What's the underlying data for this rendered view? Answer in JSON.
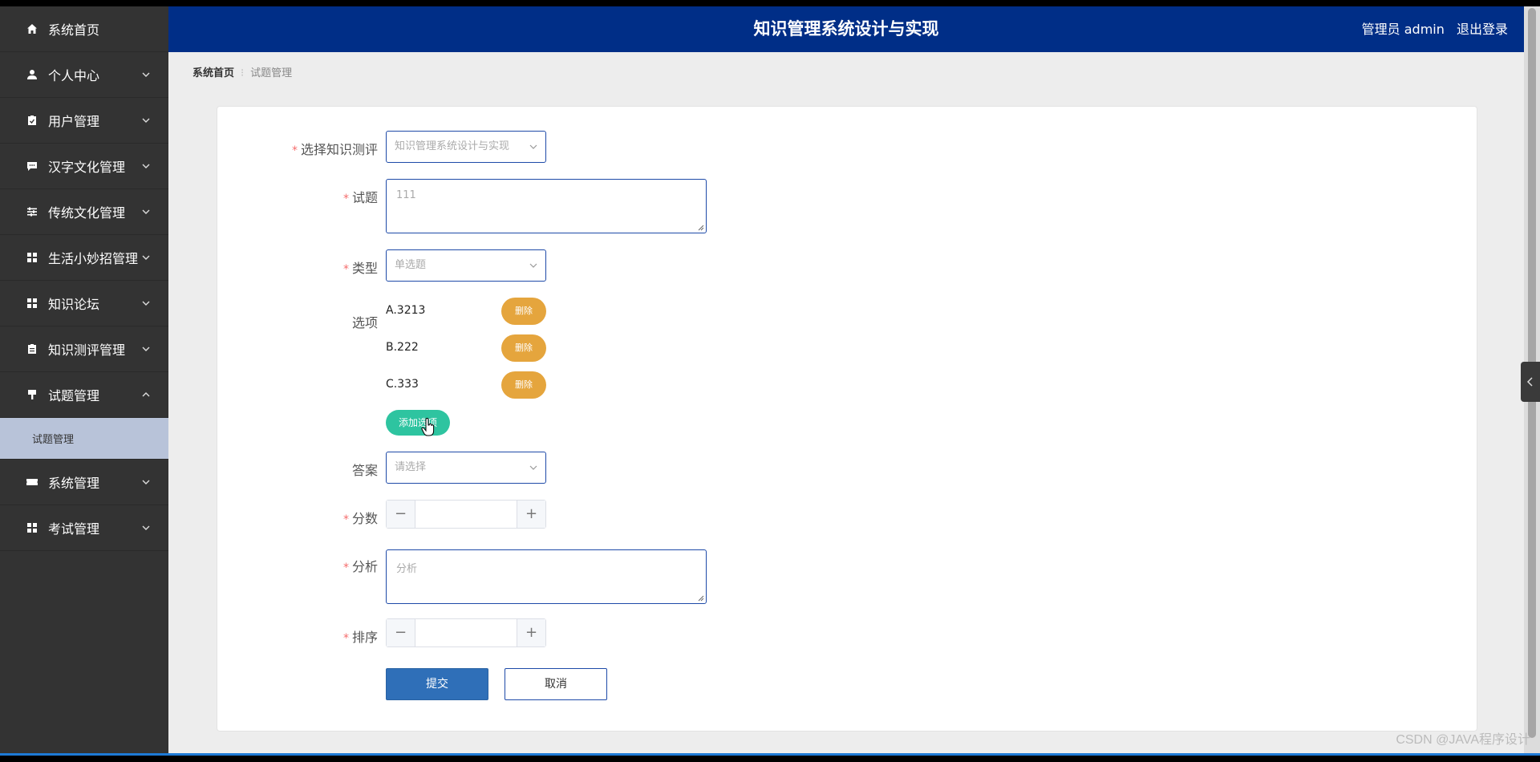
{
  "app": {
    "title": "知识管理系统设计与实现",
    "user_text": "管理员 admin",
    "logout_label": "退出登录"
  },
  "sidebar": {
    "items": [
      {
        "label": "系统首页",
        "icon": "home-icon"
      },
      {
        "label": "个人中心",
        "icon": "user-icon"
      },
      {
        "label": "用户管理",
        "icon": "clipboard-check-icon"
      },
      {
        "label": "汉字文化管理",
        "icon": "chat-icon"
      },
      {
        "label": "传统文化管理",
        "icon": "sliders-icon"
      },
      {
        "label": "生活小妙招管理",
        "icon": "grid-icon"
      },
      {
        "label": "知识论坛",
        "icon": "grid-icon"
      },
      {
        "label": "知识测评管理",
        "icon": "clipboard-icon"
      },
      {
        "label": "试题管理",
        "icon": "brush-icon"
      },
      {
        "label": "系统管理",
        "icon": "ticket-icon"
      },
      {
        "label": "考试管理",
        "icon": "grid-icon"
      }
    ],
    "active_sub": "试题管理"
  },
  "breadcrumb": {
    "home": "系统首页",
    "current": "试题管理"
  },
  "form": {
    "exam_label": "选择知识测评",
    "exam_value": "知识管理系统设计与实现",
    "question_label": "试题",
    "question_placeholder": "111",
    "type_label": "类型",
    "type_value": "单选题",
    "options_label": "选项",
    "options": [
      {
        "text": "A.3213",
        "delete_label": "删除"
      },
      {
        "text": "B.222",
        "delete_label": "删除"
      },
      {
        "text": "C.333",
        "delete_label": "删除"
      }
    ],
    "add_option_label": "添加选项",
    "answer_label": "答案",
    "answer_placeholder": "请选择",
    "score_label": "分数",
    "score_value": "",
    "analysis_label": "分析",
    "analysis_placeholder": "分析",
    "sort_label": "排序",
    "sort_value": "",
    "submit_label": "提交",
    "cancel_label": "取消"
  },
  "watermark": "CSDN @JAVA程序设计",
  "colors": {
    "header": "#002e87",
    "sidebar": "#333333",
    "submenu_active": "#b8c3d9",
    "delete_button": "#e5a53d",
    "add_button": "#2ec4a0",
    "submit_button": "#2f6fb8",
    "required_star": "#f56c6c"
  }
}
